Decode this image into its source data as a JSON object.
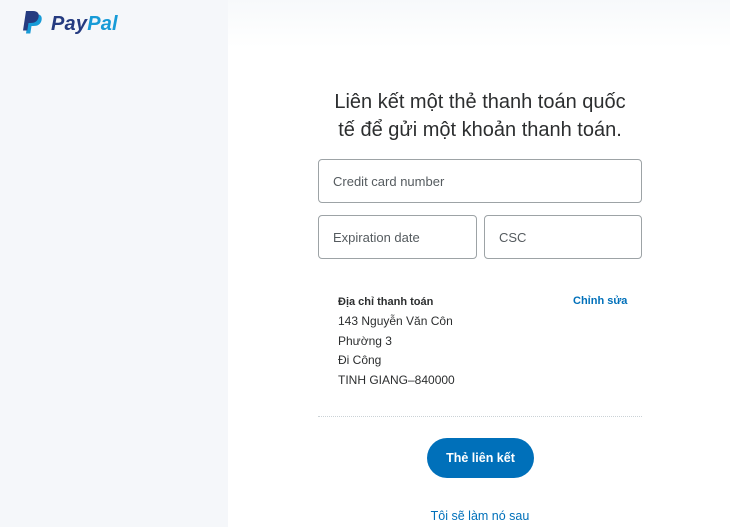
{
  "brand": {
    "name_part1": "Pay",
    "name_part2": "Pal"
  },
  "heading": {
    "line1": "Liên kết một thẻ thanh toán quốc",
    "line2": "tế để gửi một khoản thanh toán."
  },
  "form": {
    "card_number_placeholder": "Credit card number",
    "expiration_placeholder": "Expiration date",
    "csc_placeholder": "CSC"
  },
  "billing_address": {
    "label": "Địa chỉ thanh toán",
    "edit_label": "Chỉnh sửa",
    "lines": [
      "143 Nguyễn Văn Côn",
      "Phường 3",
      "Đi Công",
      "TINH GIANG–840000"
    ]
  },
  "actions": {
    "link_card_label": "Thẻ liên kết",
    "later_label": "Tôi sẽ làm nó sau"
  },
  "colors": {
    "primary": "#0070ba",
    "brand_dark": "#253b80",
    "brand_light": "#179bd7",
    "text": "#2c2e2f"
  }
}
